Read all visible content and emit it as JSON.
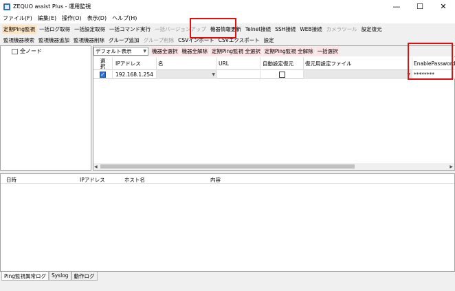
{
  "window": {
    "title": "ZEQUO assist Plus - 運用監視",
    "minimize": "—",
    "maximize": "☐",
    "close": "✕"
  },
  "menu": [
    "ファイル(F)",
    "編集(E)",
    "操作(O)",
    "表示(D)",
    "ヘルプ(H)"
  ],
  "toolbar1": [
    {
      "label": "定期Ping監視",
      "state": "active"
    },
    {
      "label": "一括ログ取得",
      "state": "normal"
    },
    {
      "label": "一括設定取得",
      "state": "normal"
    },
    {
      "label": "一括コマンド実行",
      "state": "normal"
    },
    {
      "label": "一括バージョンアップ",
      "state": "disabled"
    },
    {
      "label": "機器情報更新",
      "state": "normal"
    },
    {
      "label": "Telnet接続",
      "state": "normal"
    },
    {
      "label": "SSH接続",
      "state": "normal"
    },
    {
      "label": "WEB接続",
      "state": "normal"
    },
    {
      "label": "カメラツール",
      "state": "disabled"
    },
    {
      "label": "設定復元",
      "state": "normal"
    }
  ],
  "toolbar2": [
    {
      "label": "監視機器検索",
      "state": "normal"
    },
    {
      "label": "監視機器追加",
      "state": "normal"
    },
    {
      "label": "監視機器削除",
      "state": "normal"
    },
    {
      "label": "グループ追加",
      "state": "normal"
    },
    {
      "label": "グループ削除",
      "state": "disabled"
    },
    {
      "label": "CSVインポート",
      "state": "normal"
    },
    {
      "label": "CSVエクスポート",
      "state": "normal"
    },
    {
      "label": "設定",
      "state": "normal"
    }
  ],
  "tree": {
    "root": "全ノード"
  },
  "grid_toolbar": {
    "view_select": "デフォルト表示",
    "buttons": [
      "機器全選択",
      "機器全解除",
      "定期Ping監視 全選択",
      "定期Ping監視 全解除",
      "一括選択"
    ]
  },
  "grid": {
    "headers": {
      "select": [
        "選",
        "択"
      ],
      "ip": "IPアドレス",
      "name": "名",
      "url": "URL",
      "auto_restore": "自動設定復元",
      "restore_file": "復元用設定ファイル",
      "enable_password": "EnablePassword"
    },
    "row": {
      "selected": true,
      "ip": "192.168.1.254",
      "name": "",
      "url": "",
      "auto_restore": false,
      "restore_file": "",
      "enable_password": "********"
    }
  },
  "log": {
    "headers": {
      "time": "日時",
      "ip": "IPアドレス",
      "host": "ホスト名",
      "content": "内容"
    }
  },
  "tabs": [
    "Ping監視異常ログ",
    "Syslog",
    "動作ログ"
  ],
  "colors": {
    "highlight": "#e01010",
    "active_tool": "#fbe3c5",
    "pink_button": "#fbe2e5",
    "checkbox": "#2b6fd6"
  }
}
